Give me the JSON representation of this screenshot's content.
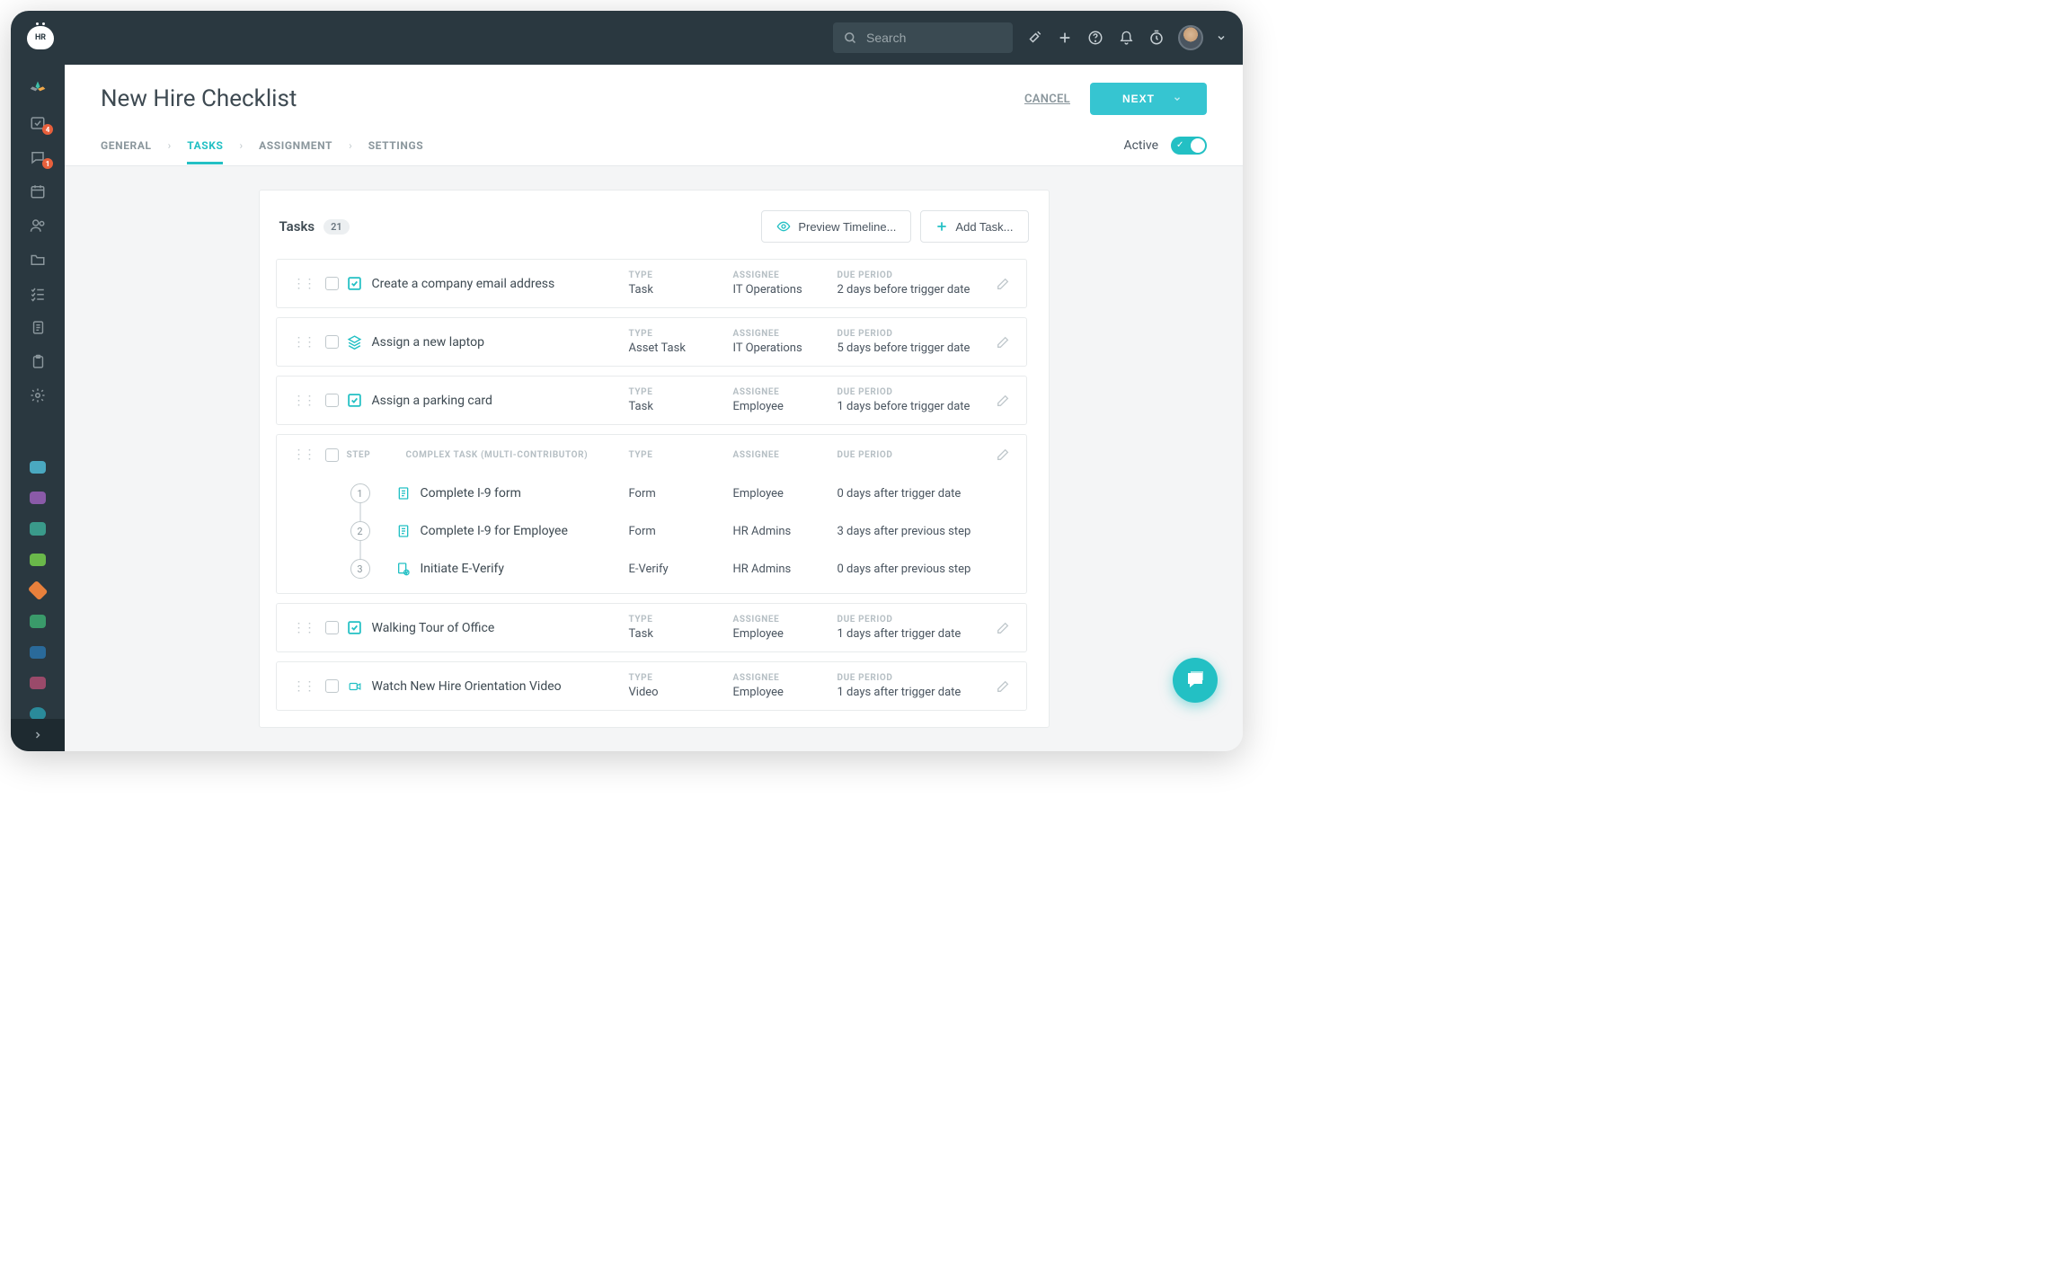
{
  "brand_badge": "HR",
  "search": {
    "placeholder": "Search"
  },
  "header": {
    "title": "New Hire Checklist",
    "cancel": "CANCEL",
    "next": "NEXT"
  },
  "tabs": [
    "GENERAL",
    "TASKS",
    "ASSIGNMENT",
    "SETTINGS"
  ],
  "active_tab": "TASKS",
  "status": {
    "label": "Active",
    "on": true
  },
  "panel": {
    "title": "Tasks",
    "count": "21",
    "preview_btn": "Preview Timeline...",
    "add_btn": "Add Task..."
  },
  "column_labels": {
    "type": "TYPE",
    "assignee": "ASSIGNEE",
    "due": "DUE PERIOD",
    "step": "STEP",
    "complex": "COMPLEX TASK (MULTI-CONTRIBUTOR)"
  },
  "tasks": [
    {
      "icon": "check",
      "title": "Create a company email address",
      "type": "Task",
      "assignee": "IT Operations",
      "due": "2 days before trigger date"
    },
    {
      "icon": "stack",
      "title": "Assign a new laptop",
      "type": "Asset Task",
      "assignee": "IT Operations",
      "due": "5 days before trigger date"
    },
    {
      "icon": "check",
      "title": "Assign a parking card",
      "type": "Task",
      "assignee": "Employee",
      "due": "1 days before trigger date"
    }
  ],
  "complex_steps": [
    {
      "num": "1",
      "icon": "form",
      "title": "Complete I-9 form",
      "type": "Form",
      "assignee": "Employee",
      "due": "0 days after trigger date"
    },
    {
      "num": "2",
      "icon": "form",
      "title": "Complete I-9 for Employee",
      "type": "Form",
      "assignee": "HR Admins",
      "due": "3 days after previous step"
    },
    {
      "num": "3",
      "icon": "verify",
      "title": "Initiate E-Verify",
      "type": "E-Verify",
      "assignee": "HR Admins",
      "due": "0 days after previous step"
    }
  ],
  "tasks_after": [
    {
      "icon": "check",
      "title": "Walking Tour of Office",
      "type": "Task",
      "assignee": "Employee",
      "due": "1 days after trigger date"
    },
    {
      "icon": "video",
      "title": "Watch New Hire Orientation Video",
      "type": "Video",
      "assignee": "Employee",
      "due": "1 days after trigger date"
    }
  ],
  "sidebar_badges": {
    "item1": "4",
    "item2": "1"
  },
  "colors": {
    "accent": "#23c0c4",
    "dark": "#2a3840"
  }
}
